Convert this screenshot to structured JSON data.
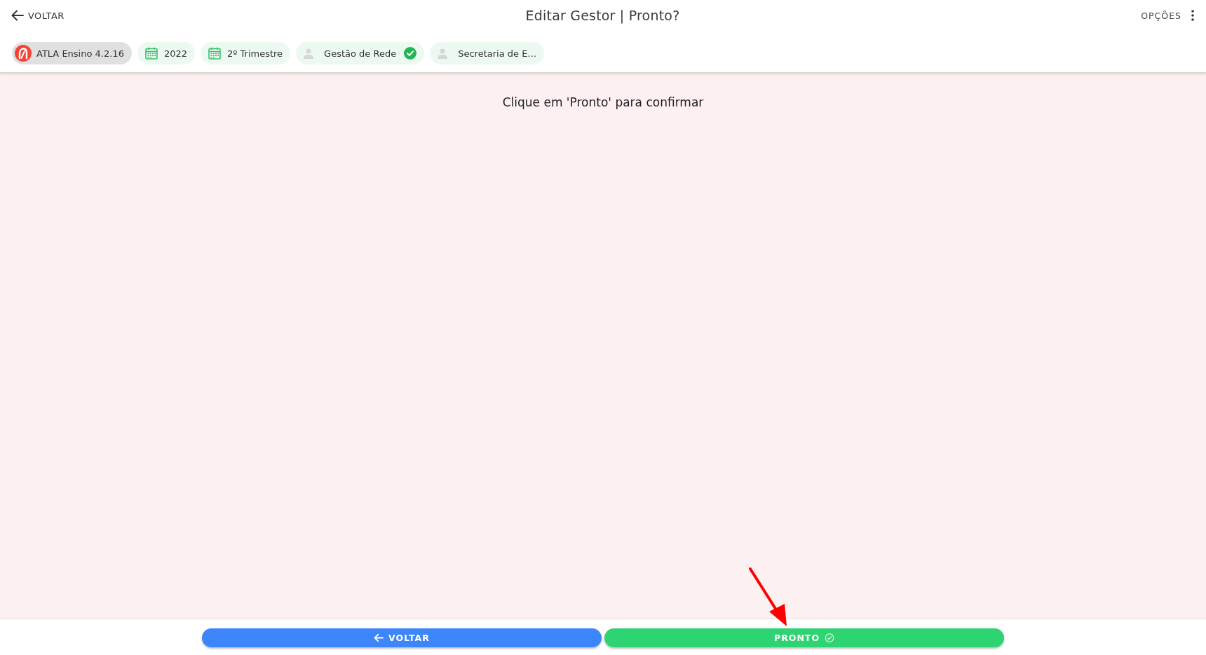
{
  "header": {
    "back_button": {
      "label": "VOLTAR"
    },
    "title": "Editar Gestor | Pronto?",
    "options_button": {
      "label": "OPÇÕES"
    }
  },
  "chips": [
    {
      "kind": "app",
      "label": "ATLA Ensino 4.2.16",
      "verified": false
    },
    {
      "kind": "calendar",
      "label": "2022",
      "verified": false
    },
    {
      "kind": "calendar",
      "label": "2º Trimestre",
      "verified": false
    },
    {
      "kind": "user",
      "label": "Gestão de Rede",
      "verified": true
    },
    {
      "kind": "user",
      "label": "Secretaria de E…",
      "verified": false
    }
  ],
  "message": "Clique em 'Pronto' para confirmar",
  "footer": {
    "buttons": [
      {
        "kind": "back",
        "label": "VOLTAR"
      },
      {
        "kind": "confirm",
        "label": "PRONTO"
      }
    ]
  }
}
